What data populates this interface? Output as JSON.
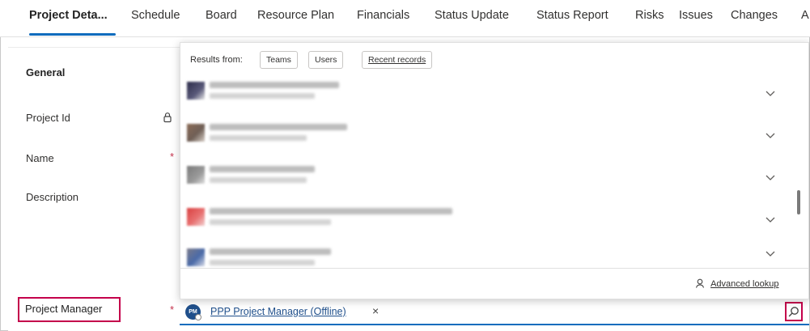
{
  "tabs": [
    {
      "label": "Project Deta..."
    },
    {
      "label": "Schedule"
    },
    {
      "label": "Board"
    },
    {
      "label": "Resource Plan"
    },
    {
      "label": "Financials"
    },
    {
      "label": "Status Update"
    },
    {
      "label": "Status Report"
    },
    {
      "label": "Risks"
    },
    {
      "label": "Issues"
    },
    {
      "label": "Changes"
    },
    {
      "label": "A"
    }
  ],
  "form": {
    "section_title": "General",
    "project_id_label": "Project Id",
    "name_label": "Name",
    "description_label": "Description",
    "project_manager_label": "Project Manager",
    "required_mark": "*"
  },
  "lookup": {
    "avatar_initials": "PM",
    "selected_value": "PPP Project Manager (Offline)",
    "remove_symbol": "×",
    "dropdown": {
      "results_from_label": "Results from:",
      "filters": [
        "Teams",
        "Users"
      ],
      "recent_records_label": "Recent records",
      "advanced_lookup_label": "Advanced lookup"
    }
  },
  "colors": {
    "accent": "#0f6cbd",
    "highlight_box": "#c4004b",
    "required": "#c4314b"
  }
}
